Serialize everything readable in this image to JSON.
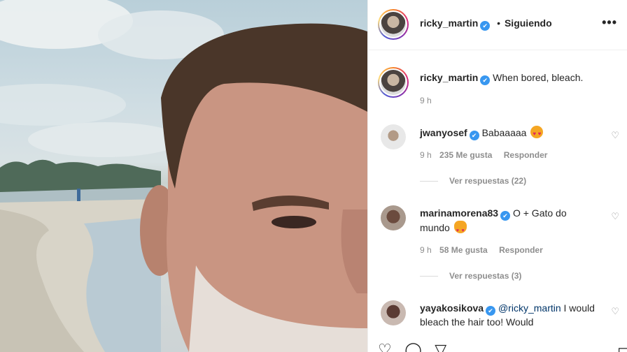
{
  "colors": {
    "link": "#003569",
    "verified": "#3897f0",
    "muted": "#8e8e8e",
    "text": "#262626"
  },
  "photo": {
    "alt_icon": "selfie-photo"
  },
  "header": {
    "username": "ricky_martin",
    "dot": "•",
    "follow_state": "Siguiendo",
    "more": "•••"
  },
  "caption": {
    "username": "ricky_martin",
    "text": "When bored, bleach.",
    "time": "9 h"
  },
  "comments": [
    {
      "username": "jwanyosef",
      "text": "Babaaaaa",
      "emoji": "smiling-face-with-heart-eyes",
      "time": "9 h",
      "likes": "235 Me gusta",
      "reply": "Responder",
      "view_replies": "Ver respuestas (22)"
    },
    {
      "username": "marinamorena83",
      "text": "O + Gato do mundo",
      "emoji": "heart-eyes-cat",
      "time": "9 h",
      "likes": "58 Me gusta",
      "reply": "Responder",
      "view_replies": "Ver respuestas (3)"
    },
    {
      "username": "yayakosikova",
      "mention": "@ricky_martin",
      "text": "I would bleach the hair too! Would"
    }
  ],
  "actions": [
    "heart-icon",
    "comment-icon",
    "share-icon",
    "save-icon"
  ]
}
